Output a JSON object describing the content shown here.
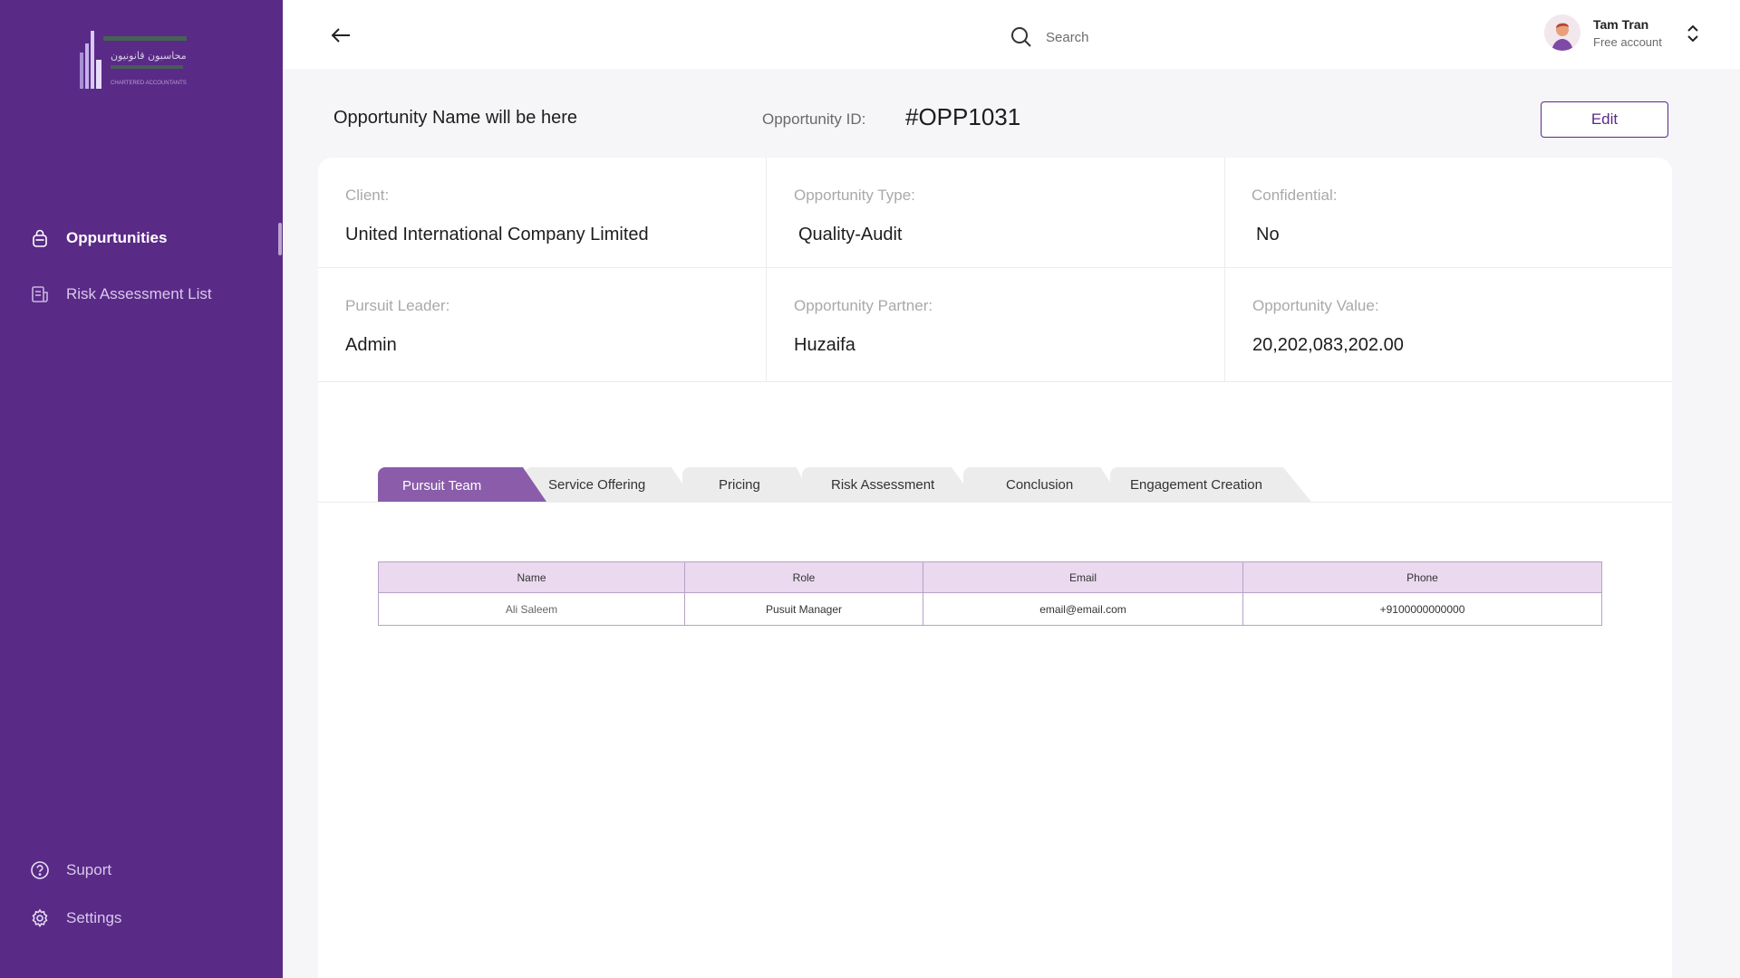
{
  "brand": {
    "logo_arabic_line1": "محاسبون قانونيون",
    "logo_sub": "CHARTERED ACCOUNTANTS",
    "primary_color": "#5a2a87",
    "accent_color": "#8a5ca9"
  },
  "sidebar": {
    "items": [
      {
        "label": "Oppurtunities",
        "icon": "bag-icon",
        "active": true
      },
      {
        "label": "Risk Assessment List",
        "icon": "document-list-icon",
        "active": false
      }
    ],
    "bottom_items": [
      {
        "label": "Suport",
        "icon": "help-circle-icon"
      },
      {
        "label": "Settings",
        "icon": "gear-icon"
      }
    ]
  },
  "topbar": {
    "search_label": "Search",
    "user_name": "Tam Tran",
    "user_plan": "Free account"
  },
  "header": {
    "opportunity_name": "Opportunity Name will be here",
    "opportunity_id_label": "Opportunity ID:",
    "opportunity_id": "#OPP1031",
    "edit_label": "Edit"
  },
  "details": {
    "client_label": "Client:",
    "client": "United International Company Limited",
    "type_label": "Opportunity Type:",
    "type": "Quality-Audit",
    "confidential_label": "Confidential:",
    "confidential": "No",
    "leader_label": "Pursuit Leader:",
    "leader": "Admin",
    "partner_label": "Opportunity Partner:",
    "partner": "Huzaifa",
    "value_label": "Opportunity Value:",
    "value": "20,202,083,202.00"
  },
  "tabs": [
    {
      "label": "Pursuit Team",
      "active": true
    },
    {
      "label": "Service Offering",
      "active": false
    },
    {
      "label": "Pricing",
      "active": false
    },
    {
      "label": "Risk Assessment",
      "active": false
    },
    {
      "label": "Conclusion",
      "active": false
    },
    {
      "label": "Engagement Creation",
      "active": false
    }
  ],
  "team_table": {
    "columns": [
      "Name",
      "Role",
      "Email",
      "Phone"
    ],
    "rows": [
      [
        "Ali Saleem",
        "Pusuit Manager",
        "email@email.com",
        "+9100000000000"
      ]
    ]
  }
}
